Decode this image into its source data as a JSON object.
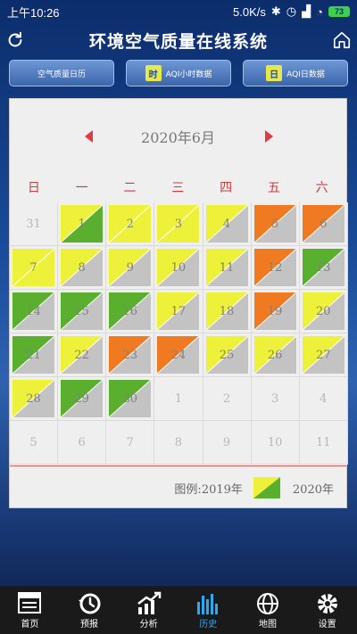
{
  "status_bar": {
    "time": "上午10:26",
    "speed": "5.0K/s",
    "battery": "73"
  },
  "header": {
    "title": "环境空气质量在线系统"
  },
  "tabs": [
    {
      "label": "空气质量日历",
      "badge": ""
    },
    {
      "label": "AQI小时数据",
      "badge": "时"
    },
    {
      "label": "AQI日数据",
      "badge": "日"
    }
  ],
  "calendar": {
    "month_label": "2020年6月",
    "weekdays": [
      "日",
      "一",
      "二",
      "三",
      "四",
      "五",
      "六"
    ],
    "colors": {
      "green": "#5aaf2e",
      "yellow": "#eef13a",
      "orange": "#ef7a21",
      "gray": "#c3c3c3"
    },
    "days": [
      {
        "n": "31",
        "other": true
      },
      {
        "n": "1",
        "t": "yellow",
        "b": "green"
      },
      {
        "n": "2",
        "t": "yellow",
        "b": "yellow"
      },
      {
        "n": "3",
        "t": "yellow",
        "b": "yellow"
      },
      {
        "n": "4",
        "t": "yellow",
        "b": "gray"
      },
      {
        "n": "5",
        "t": "orange",
        "b": "gray"
      },
      {
        "n": "6",
        "t": "orange",
        "b": "gray"
      },
      {
        "n": "7",
        "t": "yellow",
        "b": "yellow"
      },
      {
        "n": "8",
        "t": "yellow",
        "b": "gray"
      },
      {
        "n": "9",
        "t": "yellow",
        "b": "gray"
      },
      {
        "n": "10",
        "t": "yellow",
        "b": "gray"
      },
      {
        "n": "11",
        "t": "yellow",
        "b": "gray"
      },
      {
        "n": "12",
        "t": "orange",
        "b": "gray"
      },
      {
        "n": "13",
        "t": "green",
        "b": "gray"
      },
      {
        "n": "14",
        "t": "green",
        "b": "gray"
      },
      {
        "n": "15",
        "t": "green",
        "b": "gray"
      },
      {
        "n": "16",
        "t": "green",
        "b": "gray"
      },
      {
        "n": "17",
        "t": "yellow",
        "b": "gray"
      },
      {
        "n": "18",
        "t": "yellow",
        "b": "gray"
      },
      {
        "n": "19",
        "t": "orange",
        "b": "gray"
      },
      {
        "n": "20",
        "t": "yellow",
        "b": "gray"
      },
      {
        "n": "21",
        "t": "green",
        "b": "gray"
      },
      {
        "n": "22",
        "t": "yellow",
        "b": "gray"
      },
      {
        "n": "23",
        "t": "orange",
        "b": "gray"
      },
      {
        "n": "24",
        "t": "orange",
        "b": "gray"
      },
      {
        "n": "25",
        "t": "yellow",
        "b": "gray"
      },
      {
        "n": "26",
        "t": "yellow",
        "b": "gray"
      },
      {
        "n": "27",
        "t": "yellow",
        "b": "gray"
      },
      {
        "n": "28",
        "t": "yellow",
        "b": "gray"
      },
      {
        "n": "29",
        "t": "green",
        "b": "gray"
      },
      {
        "n": "30",
        "t": "green",
        "b": "gray"
      },
      {
        "n": "1",
        "other": true
      },
      {
        "n": "2",
        "other": true
      },
      {
        "n": "3",
        "other": true
      },
      {
        "n": "4",
        "other": true
      },
      {
        "n": "5",
        "other": true
      },
      {
        "n": "6",
        "other": true
      },
      {
        "n": "7",
        "other": true
      },
      {
        "n": "8",
        "other": true
      },
      {
        "n": "9",
        "other": true
      },
      {
        "n": "10",
        "other": true
      },
      {
        "n": "11",
        "other": true
      }
    ]
  },
  "legend": {
    "label": "图例:",
    "year_a": "2019年",
    "year_b": "2020年"
  },
  "nav": [
    {
      "label": "首页",
      "icon": "news-icon",
      "active": false
    },
    {
      "label": "预报",
      "icon": "forecast-icon",
      "active": false
    },
    {
      "label": "分析",
      "icon": "analysis-icon",
      "active": false
    },
    {
      "label": "历史",
      "icon": "history-icon",
      "active": true
    },
    {
      "label": "地图",
      "icon": "globe-icon",
      "active": false
    },
    {
      "label": "设置",
      "icon": "gear-icon",
      "active": false
    }
  ]
}
